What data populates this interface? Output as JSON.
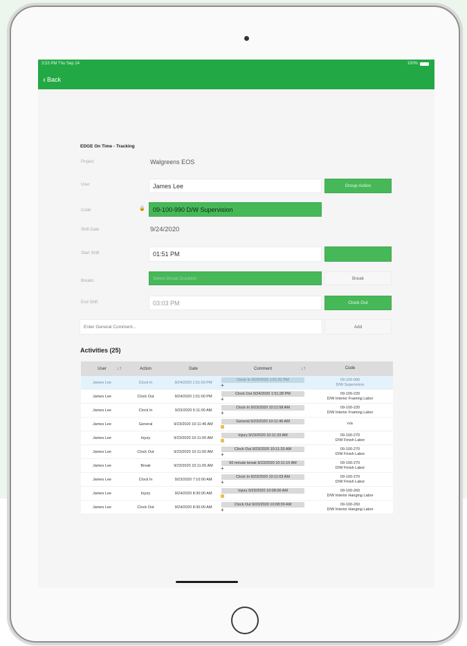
{
  "status_bar": {
    "time": "3:53 PM  Thu Sep 24",
    "battery": "100%"
  },
  "nav": {
    "back_label": "Back"
  },
  "form": {
    "title": "EDGE On Time - Tracking",
    "project_label": "Project",
    "project_value": "Walgreens EOS",
    "user_label": "User",
    "user_value": "James Lee",
    "group_action_label": "Group Action",
    "code_label": "Code",
    "code_value": "09-100-990 D/W Supervision",
    "shift_date_label": "Shift Date",
    "shift_date_value": "9/24/2020",
    "start_shift_label": "Start Shift",
    "start_shift_value": "01:51 PM",
    "start_shift_button": "",
    "breaks_label": "Breaks",
    "breaks_placeholder": "Select Break Duration",
    "break_button": "Break",
    "end_shift_label": "End Shift",
    "end_shift_value": "03:03 PM",
    "clock_out_button": "Clock Out",
    "general_comment_placeholder": "Enter General Comment...",
    "add_button": "Add"
  },
  "activities": {
    "title": "Activities (25)",
    "columns": [
      "User",
      "Action",
      "Date",
      "Comment",
      "Code"
    ],
    "rows": [
      {
        "user": "James Lee",
        "action": "Clock In",
        "date": "9/24/2020 1:51:03 PM",
        "comment": "Clock In 9/24/2020 1:51:52 PM",
        "code1": "09-100-990",
        "code2": "D/W Supervision",
        "marker": "plus",
        "selected": true
      },
      {
        "user": "James Lee",
        "action": "Clock Out",
        "date": "9/24/2020 1:51:00 PM",
        "comment": "Clock Out 9/24/2020 1:51:28 PM",
        "code1": "09-100-220",
        "code2": "D/W Interior Framing Labor",
        "marker": "plus",
        "selected": false
      },
      {
        "user": "James Lee",
        "action": "Clock In",
        "date": "9/23/2020 5:11:00 AM",
        "comment": "Clock In 9/23/2020 10:11:58 AM",
        "code1": "09-100-220",
        "code2": "D/W Interior Framing Labor",
        "marker": "plus",
        "selected": false
      },
      {
        "user": "James Lee",
        "action": "General",
        "date": "9/23/2020 10:11:46 AM",
        "comment": "General 9/23/2020 10:11:46 AM",
        "code1": "n/a",
        "code2": "",
        "marker": "note",
        "selected": false
      },
      {
        "user": "James Lee",
        "action": "Injury",
        "date": "9/23/2020 10:11:00 AM",
        "comment": "Injury 9/23/2020 10:11:33 AM",
        "code1": "09-100-270",
        "code2": "D/W Finish Labor",
        "marker": "note",
        "selected": false
      },
      {
        "user": "James Lee",
        "action": "Clock Out",
        "date": "9/23/2020 10:11:00 AM",
        "comment": "Clock Out 9/23/2020 10:11:33 AM",
        "code1": "09-100-270",
        "code2": "D/W Finish Labor",
        "marker": "plus",
        "selected": false
      },
      {
        "user": "James Lee",
        "action": "Break",
        "date": "9/23/2020 10:11:05 AM",
        "comment": "60 minute break 9/23/2020 10:11:10 AM",
        "code1": "09-100-270",
        "code2": "D/W Finish Labor",
        "marker": "plus",
        "selected": false
      },
      {
        "user": "James Lee",
        "action": "Clock In",
        "date": "9/23/2020 7:10:00 AM",
        "comment": "Clock In 9/23/2020 10:11:03 AM",
        "code1": "09-100-270",
        "code2": "D/W Finish Labor",
        "marker": "plus",
        "selected": false
      },
      {
        "user": "James Lee",
        "action": "Injury",
        "date": "9/24/2020 8:30:00 AM",
        "comment": "Injury 9/23/2020 10:08:00 AM",
        "code1": "09-100-260",
        "code2": "D/W Interior Hanging Labor",
        "marker": "note",
        "selected": false
      },
      {
        "user": "James Lee",
        "action": "Clock Out",
        "date": "9/24/2020 8:30:00 AM",
        "comment": "Clock Out 9/23/2020 10:08:00 AM",
        "code1": "09-100-260",
        "code2": "D/W Interior Hanging Labor",
        "marker": "plus",
        "selected": false
      }
    ]
  },
  "colors": {
    "brand_green": "#22a845",
    "button_green": "#47b858",
    "sort_blue": "#1e5fc0",
    "selected_row": "#e3f2fb"
  }
}
